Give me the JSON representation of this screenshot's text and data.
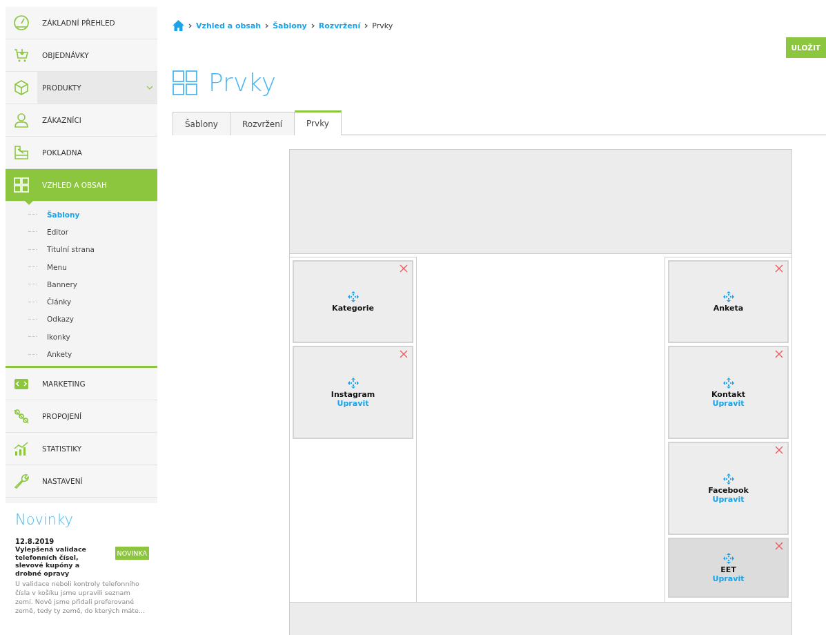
{
  "sidebar": {
    "items": [
      {
        "label": "ZÁKLADNÍ PŘEHLED",
        "selected": false,
        "hovered": false,
        "expandable": false
      },
      {
        "label": "OBJEDNÁVKY",
        "selected": false,
        "hovered": false,
        "expandable": false
      },
      {
        "label": "PRODUKTY",
        "selected": false,
        "hovered": true,
        "expandable": true
      },
      {
        "label": "ZÁKAZNÍCI",
        "selected": false,
        "hovered": false,
        "expandable": false
      },
      {
        "label": "POKLADNA",
        "selected": false,
        "hovered": false,
        "expandable": false
      },
      {
        "label": "VZHLED A OBSAH",
        "selected": true,
        "hovered": false,
        "expandable": false,
        "children": [
          {
            "label": "Šablony",
            "selected": true
          },
          {
            "label": "Editor",
            "selected": false
          },
          {
            "label": "Titulní strana",
            "selected": false
          },
          {
            "label": "Menu",
            "selected": false
          },
          {
            "label": "Bannery",
            "selected": false
          },
          {
            "label": "Články",
            "selected": false
          },
          {
            "label": "Odkazy",
            "selected": false
          },
          {
            "label": "Ikonky",
            "selected": false
          },
          {
            "label": "Ankety",
            "selected": false
          }
        ]
      },
      {
        "label": "MARKETING",
        "selected": false,
        "hovered": false,
        "expandable": false
      },
      {
        "label": "PROPOJENÍ",
        "selected": false,
        "hovered": false,
        "expandable": false
      },
      {
        "label": "STATISTIKY",
        "selected": false,
        "hovered": false,
        "expandable": false
      },
      {
        "label": "NASTAVENÍ",
        "selected": false,
        "hovered": false,
        "expandable": false
      }
    ],
    "news": {
      "title": "Novinky",
      "date": "12.8.2019",
      "headline": "Vylepšená validace telefonních čísel, slevové kupóny a drobné opravy",
      "badge": "NOVINKA",
      "body": "U validace neboli kontroly telefonního čísla v košíku jsme upravili seznam zemí. Nově jsme přidali preferované země, tedy ty země, do kterých máte..."
    }
  },
  "breadcrumb": [
    "Vzhled a obsah",
    "Šablony",
    "Rozvržení",
    "Prvky"
  ],
  "save_button": "ULOŽIT",
  "page_title": "Prvky",
  "tabs": [
    {
      "label": "Šablony",
      "selected": false
    },
    {
      "label": "Rozvržení",
      "selected": false
    },
    {
      "label": "Prvky",
      "selected": true
    }
  ],
  "layout": {
    "left_column": [
      {
        "name": "Kategorie",
        "selected": false
      },
      {
        "name": "Instagram",
        "edit_link": "Upravit",
        "selected": false
      }
    ],
    "right_column": [
      {
        "name": "Anketa",
        "selected": false
      },
      {
        "name": "Kontakt",
        "edit_link": "Upravit",
        "selected": false
      },
      {
        "name": "Facebook",
        "edit_link": "Upravit",
        "selected": false
      },
      {
        "name": "EET",
        "edit_link": "Upravit",
        "selected": true
      }
    ]
  }
}
